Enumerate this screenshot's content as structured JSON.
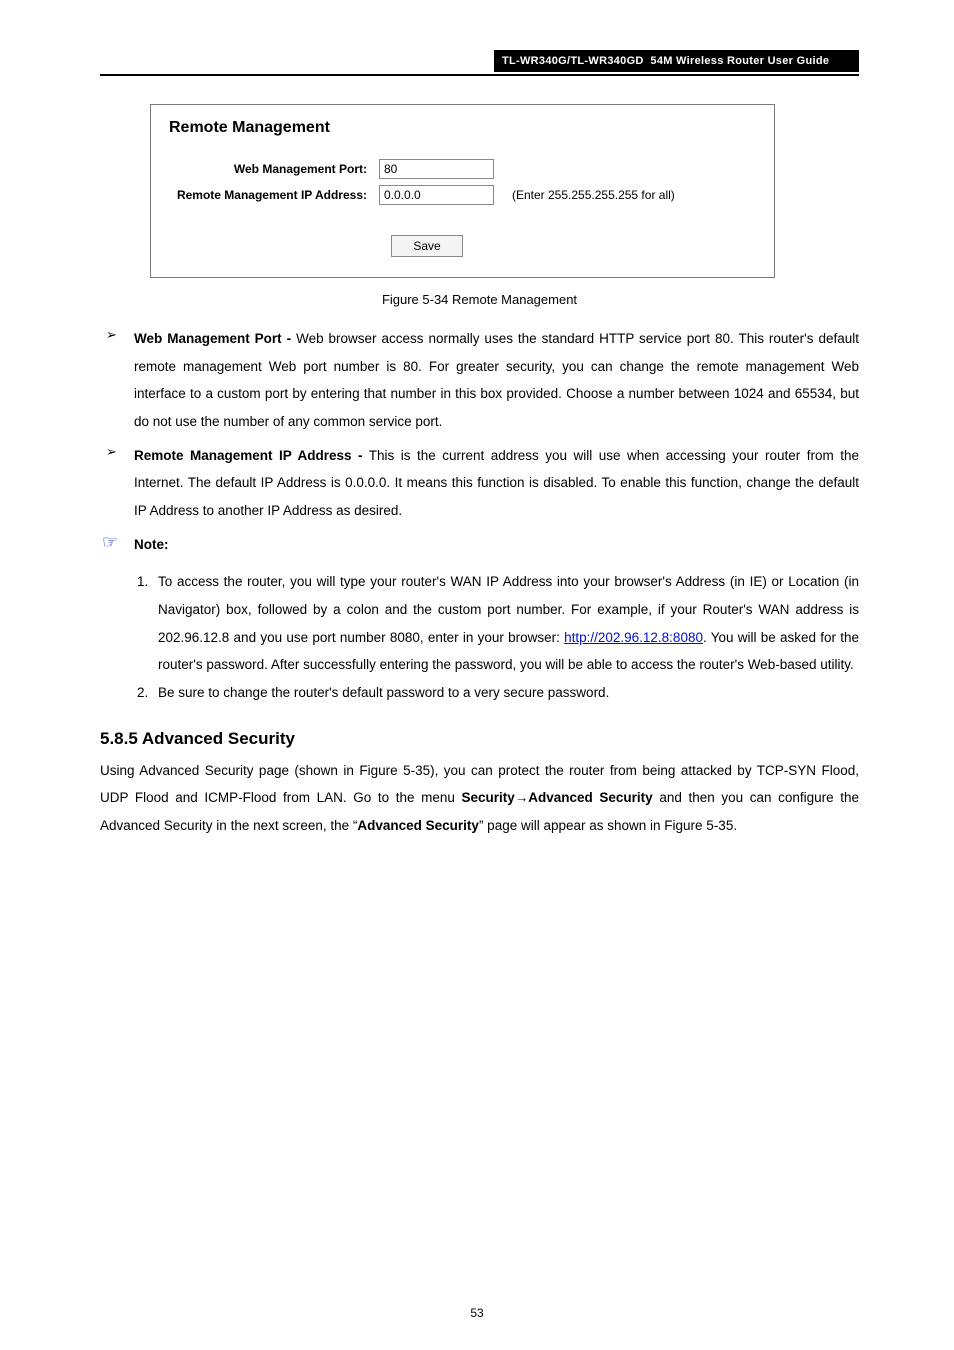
{
  "header": {
    "product": "TL-WR340G/TL-WR340GD",
    "subtitle": "54M Wireless Router User Guide"
  },
  "screenshot": {
    "title": "Remote Management",
    "rows": {
      "port": {
        "label": "Web Management Port:",
        "value": "80"
      },
      "ip": {
        "label": "Remote Management IP Address:",
        "value": "0.0.0.0",
        "hint": "(Enter 255.255.255.255 for all)"
      }
    },
    "save": "Save"
  },
  "figcaption": "Figure 5-34 Remote Management",
  "bullets": {
    "b1": {
      "term": "Web Management Port -",
      "text": " Web browser access normally uses the standard HTTP service port 80. This router's default remote management Web port number is 80. For greater security, you can change the remote management Web interface to a custom port by entering that number in this box provided. Choose a number between 1024 and 65534, but do not use the number of any common service port."
    },
    "b2": {
      "term": "Remote Management IP Address -",
      "text": " This is the current address you will use when accessing your router from the Internet. The default IP Address is 0.0.0.0. It means this function is disabled. To enable this function, change the default IP Address to another IP Address as desired."
    }
  },
  "note": {
    "label": "Note:",
    "items": [
      {
        "pre": "To access the router, you will type your router's WAN IP Address into your browser's Address (in IE) or Location (in Navigator) box, followed by a colon and the custom port number. For example, if your Router's WAN address is 202.96.12.8 and you use port number 8080, enter in your browser: ",
        "link": "http://202.96.12.8:8080",
        "post": ". You will be asked for the router's password. After successfully entering the password, you will be able to access the router's Web-based utility."
      },
      {
        "text": "Be sure to change the router's default password to a very secure password."
      }
    ]
  },
  "section": {
    "heading": "5.8.5 Advanced Security",
    "p1_a": "Using Advanced Security page (shown in Figure 5-35), you can protect the router from being attacked by TCP-SYN Flood, UDP Flood and ICMP-Flood from LAN. Go to the menu ",
    "p1_b": "Security",
    "p1_arrow": "→",
    "p1_c": "Advanced Security",
    "p1_d": " and then you can configure the Advanced Security in the next screen, the “",
    "p1_e": "Advanced Security",
    "p1_f": "” page will appear as shown in Figure 5-35."
  },
  "page_number": "53"
}
